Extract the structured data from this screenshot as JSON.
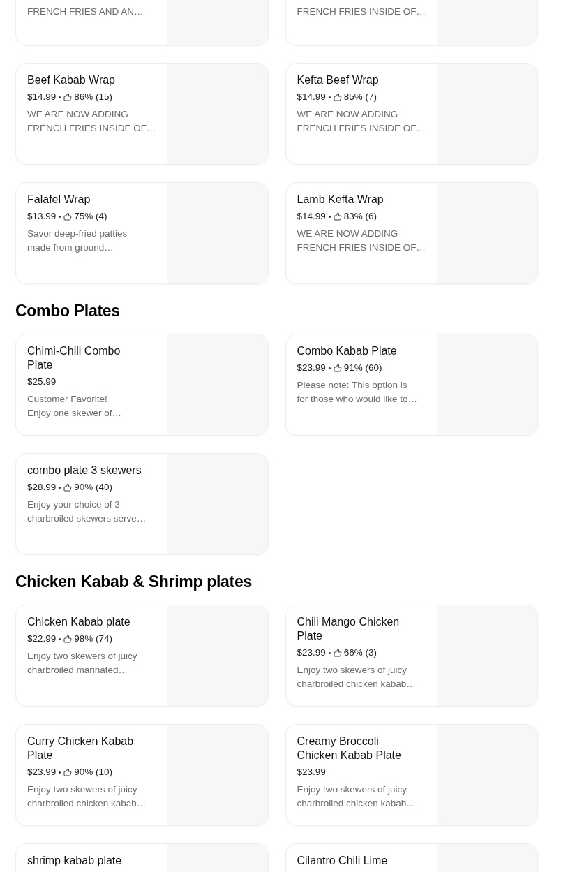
{
  "top_row": [
    {
      "description": "FRENCH FRIES AND AN…"
    },
    {
      "description": "FRENCH FRIES INSIDE OF…"
    }
  ],
  "sections": [
    {
      "items": [
        {
          "name": "Beef Kabab Wrap",
          "price": "$14.99",
          "rating": "86% (15)",
          "description": "WE ARE NOW ADDING\nFRENCH FRIES INSIDE OF…"
        },
        {
          "name": "Kefta Beef Wrap",
          "price": "$14.99",
          "rating": "85% (7)",
          "description": "WE ARE NOW ADDING\nFRENCH FRIES INSIDE OF…"
        },
        {
          "name": "Falafel Wrap",
          "price": "$13.99",
          "rating": "75% (4)",
          "description": "Savor deep-fried patties\nmade from ground…"
        },
        {
          "name": "Lamb Kefta Wrap",
          "price": "$14.99",
          "rating": "83% (6)",
          "description": "WE ARE NOW ADDING\nFRENCH FRIES INSIDE OF…"
        }
      ]
    },
    {
      "title": "Combo Plates",
      "items": [
        {
          "name": "Chimi-Chili Combo\nPlate",
          "price": "$25.99",
          "description": "Customer Favorite!\nEnjoy one skewer of…"
        },
        {
          "name": "Combo Kabab Plate",
          "price": "$23.99",
          "rating": "91% (60)",
          "description": "Please note: This option is\nfor those who would like to…"
        },
        {
          "name": "combo plate 3 skewers",
          "price": "$28.99",
          "rating": "90% (40)",
          "description": "Enjoy your choice of 3\ncharbroiled skewers serve…"
        }
      ]
    },
    {
      "title": "Chicken Kabab & Shrimp plates",
      "items": [
        {
          "name": "Chicken Kabab plate",
          "price": "$22.99",
          "rating": "98% (74)",
          "description": "Enjoy two skewers of juicy\ncharbroiled marinated…"
        },
        {
          "name": "Chili Mango Chicken\nPlate",
          "price": "$23.99",
          "rating": "66% (3)",
          "description": "Enjoy two skewers of juicy\ncharbroiled chicken kabab…"
        },
        {
          "name": "Curry Chicken Kabab\nPlate",
          "price": "$23.99",
          "rating": "90% (10)",
          "description": "Enjoy two skewers of juicy\ncharbroiled chicken kabab…"
        },
        {
          "name": "Creamy Broccoli\nChicken Kabab Plate",
          "price": "$23.99",
          "description": "Enjoy two skewers of juicy\ncharbroiled chicken kabab…"
        },
        {
          "name": "shrimp kabab plate"
        },
        {
          "name": "Cilantro Chili Lime"
        }
      ]
    }
  ]
}
